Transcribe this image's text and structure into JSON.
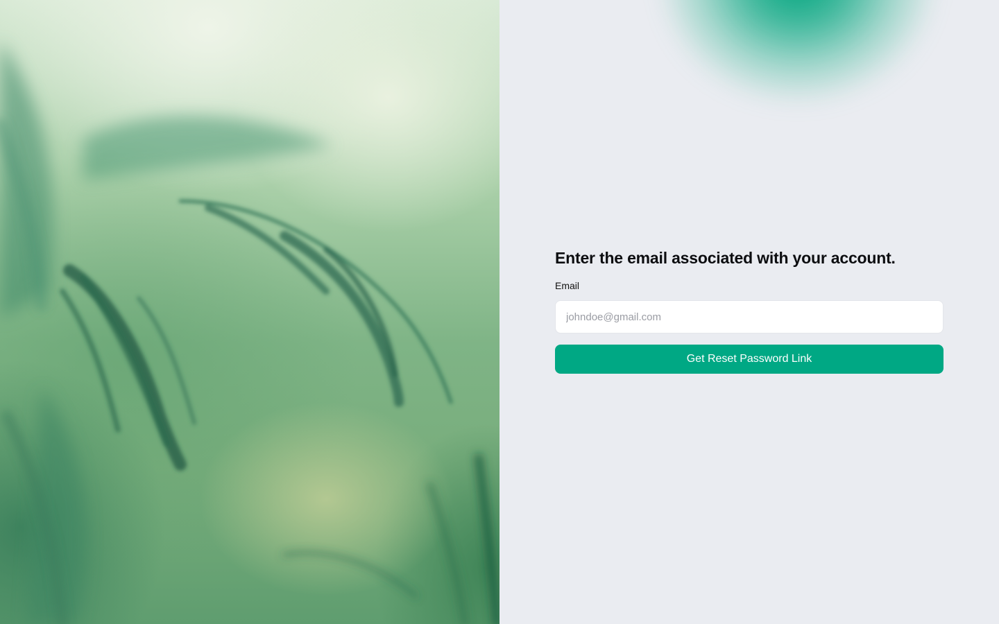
{
  "hero": {
    "image_name": "misty-fern-photo"
  },
  "reset_form": {
    "title": "Enter the email associated with your account.",
    "email_label": "Email",
    "email_placeholder": "johndoe@gmail.com",
    "email_value": "",
    "submit_label": "Get Reset Password Link"
  },
  "colors": {
    "accent": "#00a884",
    "panel_background": "#eaecf1",
    "input_background": "#ffffff",
    "title_text": "#0c0d10"
  }
}
